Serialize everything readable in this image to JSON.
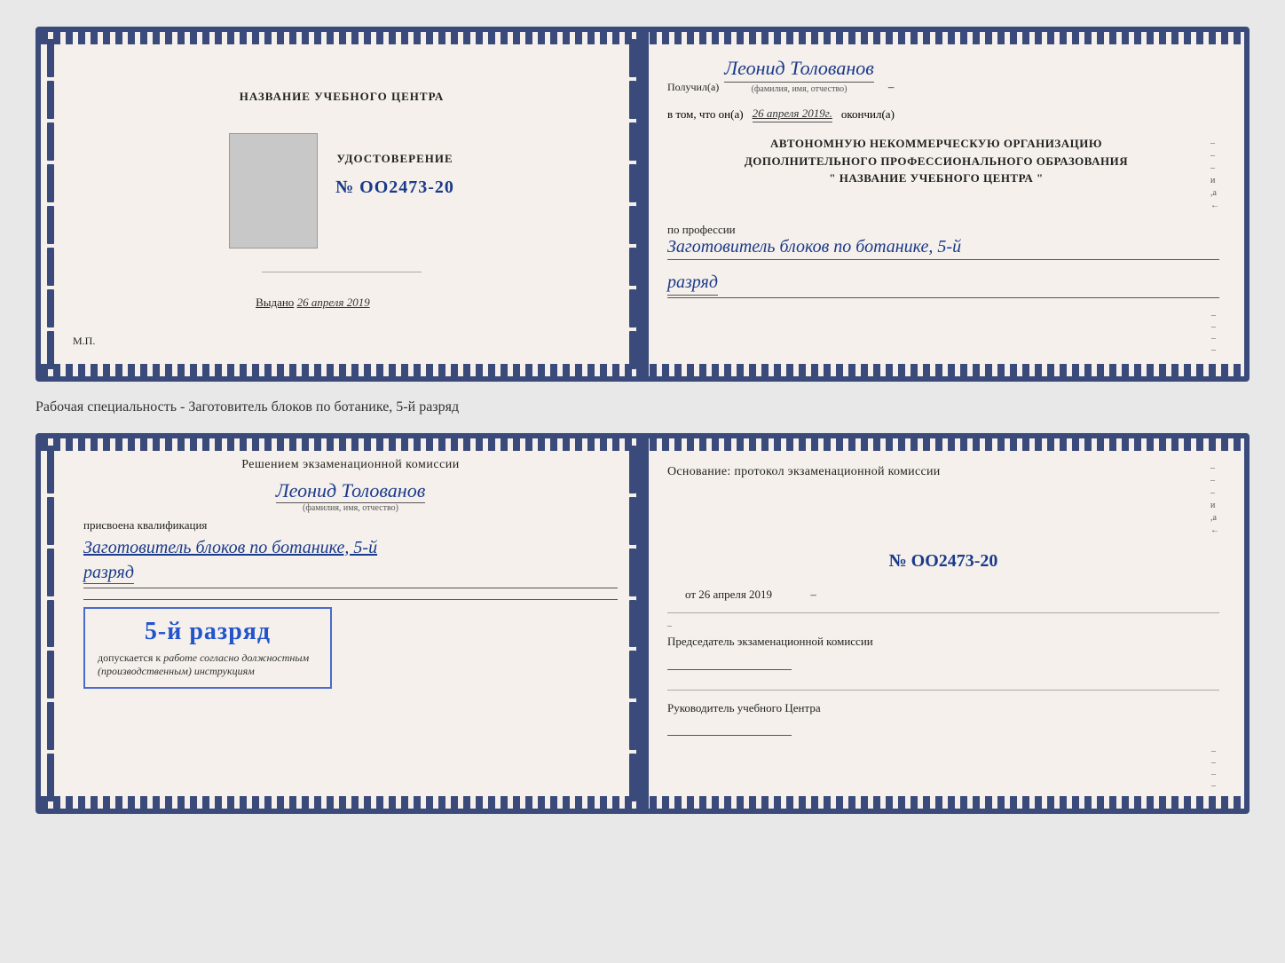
{
  "page": {
    "background": "#e8e8e8"
  },
  "doc1": {
    "left": {
      "title": "НАЗВАНИЕ УЧЕБНОГО ЦЕНТРА",
      "cert_label": "УДОСТОВЕРЕНИЕ",
      "cert_number": "№ OO2473-20",
      "issued_prefix": "Выдано",
      "issued_date": "26 апреля 2019",
      "mp_label": "М.П."
    },
    "right": {
      "received_prefix": "Получил(а)",
      "recipient_name": "Леонид Толованов",
      "recipient_subtitle": "(фамилия, имя, отчество)",
      "confirmed_prefix": "в том, что он(а)",
      "confirmed_date": "26 апреля 2019г.",
      "confirmed_suffix": "окончил(а)",
      "org_line1": "АВТОНОМНУЮ НЕКОММЕРЧЕСКУЮ ОРГАНИЗАЦИЮ",
      "org_line2": "ДОПОЛНИТЕЛЬНОГО ПРОФЕССИОНАЛЬНОГО ОБРАЗОВАНИЯ",
      "org_line3": "\"   НАЗВАНИЕ УЧЕБНОГО ЦЕНТРА   \"",
      "profession_prefix": "по профессии",
      "profession_value": "Заготовитель блоков по ботанике, 5-й",
      "rank_value": "разряд"
    }
  },
  "separator": {
    "text": "Рабочая специальность - Заготовитель блоков по ботанике, 5-й разряд"
  },
  "doc2": {
    "left": {
      "decision_text": "Решением экзаменационной комиссии",
      "person_name": "Леонид Толованов",
      "person_subtitle": "(фамилия, имя, отчество)",
      "assigned_label": "присвоена квалификация",
      "qualification": "Заготовитель блоков по ботанике, 5-й",
      "rank": "разряд",
      "stamp_rank": "5-й разряд",
      "stamp_text": "допускается к",
      "stamp_italic": "работе согласно должностным (производственным) инструкциям"
    },
    "right": {
      "basis_label": "Основание: протокол экзаменационной комиссии",
      "protocol_number": "№ OO2473-20",
      "from_prefix": "от",
      "from_date": "26 апреля 2019",
      "chairman_label": "Председатель экзаменационной комиссии",
      "center_head_label": "Руководитель учебного Центра"
    }
  }
}
